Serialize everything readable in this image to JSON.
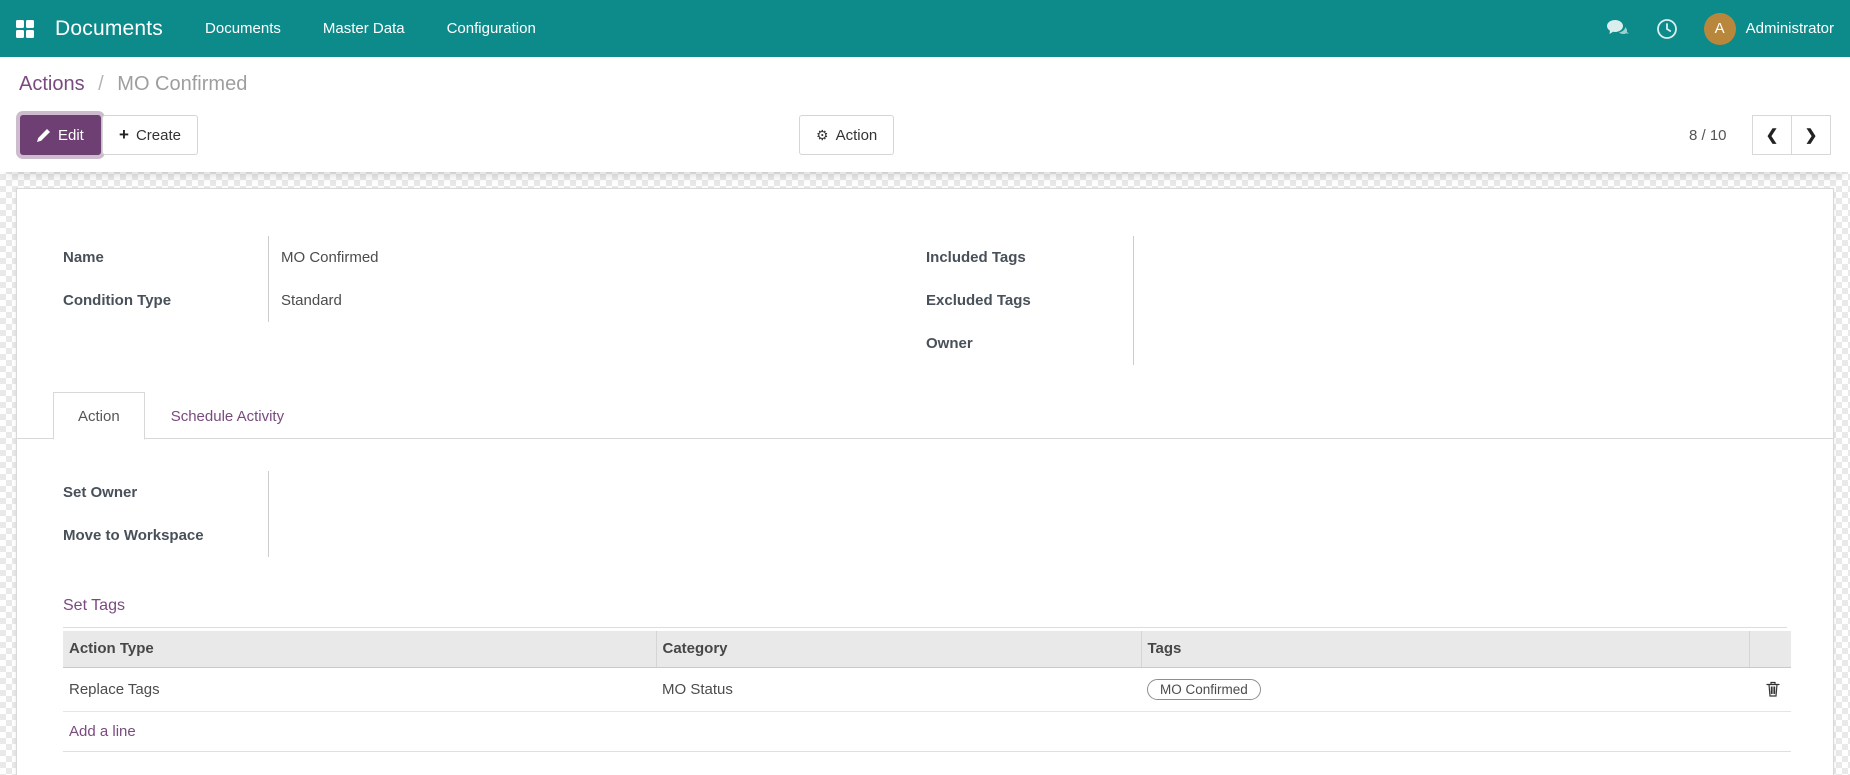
{
  "topbar": {
    "app_name": "Documents",
    "menu_items": [
      "Documents",
      "Master Data",
      "Configuration"
    ],
    "user_name": "Administrator",
    "avatar_initial": "A"
  },
  "breadcrumb": {
    "parent": "Actions",
    "separator": "/",
    "current": "MO Confirmed"
  },
  "toolbar": {
    "edit_label": "Edit",
    "create_label": "Create",
    "action_label": "Action"
  },
  "pager": {
    "counter": "8 / 10"
  },
  "form": {
    "fields_left": [
      {
        "label": "Name",
        "value": "MO Confirmed"
      },
      {
        "label": "Condition Type",
        "value": "Standard"
      }
    ],
    "fields_right": [
      {
        "label": "Included Tags",
        "value": ""
      },
      {
        "label": "Excluded Tags",
        "value": ""
      },
      {
        "label": "Owner",
        "value": ""
      }
    ],
    "tabs": {
      "action": "Action",
      "schedule": "Schedule Activity"
    },
    "tab_fields": [
      {
        "label": "Set Owner",
        "value": ""
      },
      {
        "label": "Move to Workspace",
        "value": ""
      }
    ],
    "section_title": "Set Tags"
  },
  "table": {
    "headers": {
      "action_type": "Action Type",
      "category": "Category",
      "tags": "Tags"
    },
    "row": {
      "action_type": "Replace Tags",
      "category": "MO Status",
      "tag": "MO Confirmed"
    },
    "add_line": "Add a line"
  },
  "icons": {
    "prev": "❮",
    "next": "❯",
    "gear": "⚙",
    "plus": "+"
  },
  "colors": {
    "topbar": "#0d8b8b",
    "primary": "#6d3f72",
    "link": "#7a4a7f",
    "avatar": "#b8873b"
  }
}
